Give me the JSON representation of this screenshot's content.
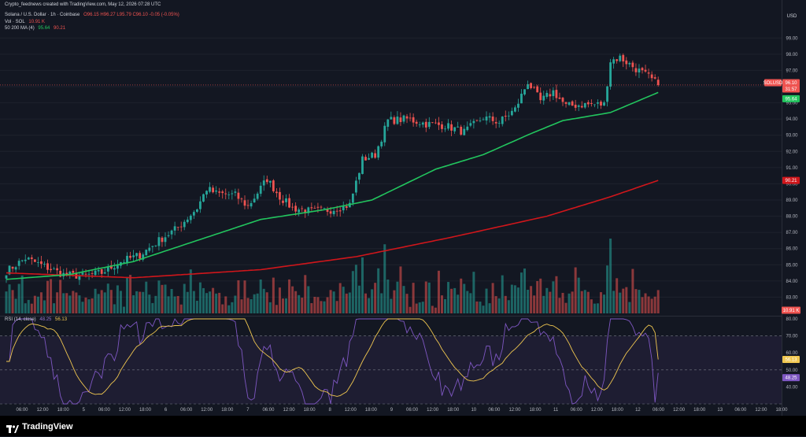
{
  "header": {
    "author_line": "Crypto_feednews created with TradingView.com, May 12, 2026 07:28 UTC"
  },
  "legend": {
    "symbol": "Solana / U.S. Dollar · 1h · Coinbase",
    "ohlc": "O96.15 H96.27 L95.79 C96.10 -0.05 (-0.05%)",
    "vol_label": "Vol · SOL",
    "vol_value": "10.91 K",
    "ma_label": "50 200 MA (4)",
    "ma50_value": "95.64",
    "ma200_value": "90.21",
    "rsi_label": "RSI (14, close)",
    "rsi_value": "48.25",
    "rsi_ma_value": "56.13"
  },
  "currency": "USD",
  "badges": {
    "symbol_tag": "SOLUSD",
    "price": "96.10",
    "countdown": "31:57",
    "ma50": "95.64",
    "ma200": "90.21",
    "volume": "10.91 K",
    "rsi_ma": "56.13",
    "rsi": "48.25"
  },
  "logo_text": "TradingView",
  "chart_data": [
    {
      "type": "candlestick",
      "title": "Solana / U.S. Dollar · 1h · Coinbase",
      "ylim": [
        82,
        99.5
      ],
      "y_ticks": [
        83,
        84,
        85,
        86,
        87,
        88,
        89,
        90,
        91,
        92,
        93,
        94,
        95,
        96,
        97,
        98,
        99
      ],
      "x_tick_labels": [
        "06:00",
        "12:00",
        "18:00",
        "5",
        "06:00",
        "12:00",
        "18:00",
        "6",
        "06:00",
        "12:00",
        "18:00",
        "7",
        "06:00",
        "12:00",
        "18:00",
        "8",
        "12:00",
        "18:00",
        "9",
        "06:00",
        "12:00",
        "18:00",
        "10",
        "06:00",
        "12:00",
        "18:00",
        "11",
        "06:00",
        "12:00",
        "18:00",
        "12",
        "06:00",
        "12:00",
        "18:00",
        "13",
        "06:00",
        "12:00",
        "18:00"
      ],
      "close_anchors": [
        [
          0,
          84.6
        ],
        [
          6,
          85.4
        ],
        [
          12,
          84.9
        ],
        [
          18,
          84.4
        ],
        [
          24,
          84.3
        ],
        [
          30,
          84.5
        ],
        [
          36,
          85.2
        ],
        [
          42,
          85.6
        ],
        [
          48,
          86.5
        ],
        [
          54,
          87.3
        ],
        [
          60,
          88.5
        ],
        [
          63,
          89.7
        ],
        [
          66,
          89.4
        ],
        [
          72,
          89.3
        ],
        [
          76,
          88.6
        ],
        [
          82,
          90.3
        ],
        [
          86,
          89.2
        ],
        [
          90,
          88.5
        ],
        [
          96,
          88.3
        ],
        [
          102,
          88.4
        ],
        [
          108,
          88.7
        ],
        [
          112,
          91.5
        ],
        [
          116,
          91.8
        ],
        [
          120,
          93.9
        ],
        [
          126,
          94.0
        ],
        [
          132,
          93.7
        ],
        [
          138,
          93.6
        ],
        [
          144,
          93.2
        ],
        [
          150,
          94.1
        ],
        [
          155,
          93.8
        ],
        [
          160,
          94.6
        ],
        [
          164,
          96.3
        ],
        [
          168,
          95.1
        ],
        [
          172,
          95.7
        ],
        [
          176,
          94.8
        ],
        [
          182,
          94.9
        ],
        [
          188,
          94.9
        ],
        [
          190,
          97.6
        ],
        [
          193,
          97.8
        ],
        [
          198,
          97.1
        ],
        [
          202,
          96.6
        ],
        [
          205,
          96.1
        ]
      ],
      "ma50_anchors": [
        [
          0,
          84.1
        ],
        [
          20,
          84.4
        ],
        [
          40,
          85.2
        ],
        [
          60,
          86.5
        ],
        [
          80,
          87.8
        ],
        [
          100,
          88.4
        ],
        [
          115,
          89.0
        ],
        [
          135,
          90.9
        ],
        [
          150,
          91.8
        ],
        [
          165,
          93.1
        ],
        [
          175,
          93.9
        ],
        [
          190,
          94.4
        ],
        [
          205,
          95.64
        ]
      ],
      "ma200_anchors": [
        [
          0,
          84.5
        ],
        [
          40,
          84.2
        ],
        [
          80,
          84.7
        ],
        [
          110,
          85.5
        ],
        [
          140,
          86.7
        ],
        [
          170,
          88.0
        ],
        [
          190,
          89.2
        ],
        [
          205,
          90.21
        ]
      ],
      "volume_last": "10.91 K",
      "series": [
        {
          "name": "MA 50",
          "color": "#22c55e",
          "last": 95.64
        },
        {
          "name": "MA 200",
          "color": "#d0161b",
          "last": 90.21
        }
      ],
      "colors": {
        "up": "#26a69a",
        "down": "#ef5350"
      }
    },
    {
      "type": "line",
      "title": "RSI (14, close)",
      "ylim": [
        30,
        80
      ],
      "y_ticks": [
        40,
        50,
        60,
        70,
        80
      ],
      "levels": [
        30,
        50,
        70
      ],
      "series": [
        {
          "name": "RSI",
          "color": "#7e57c2",
          "last": 48.25
        },
        {
          "name": "RSI MA",
          "color": "#f0c750",
          "last": 56.13
        }
      ]
    }
  ]
}
